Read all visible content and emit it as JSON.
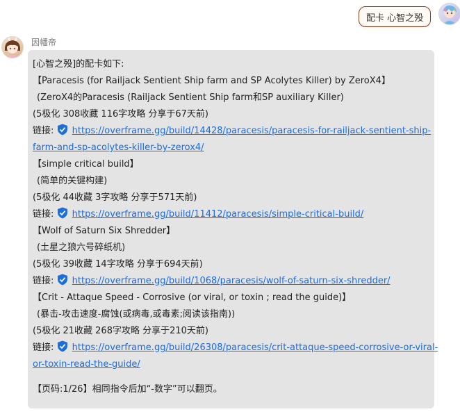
{
  "header": {
    "right_message": "配卡 心智之殁",
    "sender_name": "因幡帝"
  },
  "message": {
    "intro": "[心智之殁]的配卡如下:",
    "link_prefix": "链接:",
    "builds": [
      {
        "title": "【Paracesis (for Railjack Sentient Ship farm and SP Acolytes Killer) by ZeroX4】",
        "subtitle": "(ZeroX4的Paracesis (Railjack Sentient Ship farm和SP auxiliary Killer)",
        "stats": "(5极化 308收藏 116字攻略 分享于67天前)",
        "url_line1": "https://overframe.gg/build/14428/paracesis/paracesis-for-railjack-sentient-ship-",
        "url_line2": "farm-and-sp-acolytes-killer-by-zerox4/"
      },
      {
        "title": "【simple critical build】",
        "subtitle": "(简单的关键构建)",
        "stats": "(5极化 44收藏 3字攻略 分享于571天前)",
        "url_line1": "https://overframe.gg/build/11412/paracesis/simple-critical-build/"
      },
      {
        "title": "【Wolf of Saturn Six Shredder】",
        "subtitle": "(土星之狼六号碎纸机)",
        "stats": "(5极化 39收藏 14字攻略 分享于694天前)",
        "url_line1": "https://overframe.gg/build/1068/paracesis/wolf-of-saturn-six-shredder/"
      },
      {
        "title": "【Crit - Attaque Speed - Corrosive (or viral, or toxin ; read the guide)】",
        "subtitle": "(暴击-攻击速度-腐蚀(或病毒,或毒素;阅读该指南))",
        "stats": "(5极化 21收藏 268字攻略 分享于210天前)",
        "url_line1": "https://overframe.gg/build/26308/paracesis/crit-attaque-speed-corrosive-or-viral-",
        "url_line2": "or-toxin-read-the-guide/"
      }
    ],
    "footer": "【页码:1/26】相同指令后加“-数字”可以翻页。"
  },
  "colors": {
    "bubble_bg": "#e4e4e4",
    "link": "#1a6de0",
    "shield": "#1c6fd6",
    "right_bubble_border": "#8b3a1e"
  },
  "icons": {
    "link_badge": "shield-check-icon",
    "avatar_right": "user-avatar-icon",
    "avatar_left": "bot-avatar-icon"
  }
}
